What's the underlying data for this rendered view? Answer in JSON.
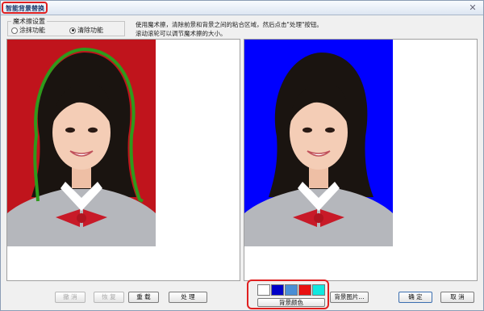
{
  "window": {
    "title": "智能背景替换",
    "close_glyph": "✕"
  },
  "mode_group": {
    "title": "魔术擦设置",
    "options": [
      {
        "label": "涂抹功能",
        "selected": false
      },
      {
        "label": "清除功能",
        "selected": true
      }
    ]
  },
  "instructions": {
    "line1": "使用魔术擦，清除前景和背景之间的粘合区域，然后点击\"处理\"按钮。",
    "line2": "滚动滚轮可以调节魔术擦的大小。"
  },
  "left_buttons": {
    "undo": "撤 消",
    "redo": "恢 复",
    "reload": "重 载",
    "process": "处 理"
  },
  "color_picker": {
    "label": "背景颜色",
    "swatches": [
      {
        "name": "white-swatch",
        "color": "#ffffff"
      },
      {
        "name": "dark-blue-swatch",
        "color": "#0000c8"
      },
      {
        "name": "light-blue-swatch",
        "color": "#4a8fd6"
      },
      {
        "name": "red-swatch",
        "color": "#e81010"
      },
      {
        "name": "cyan-swatch",
        "color": "#10e8e0"
      }
    ]
  },
  "right_buttons": {
    "background_image": "背景图片...",
    "ok": "确 定",
    "cancel": "取 消"
  },
  "colors": {
    "original_background": "#c0141c",
    "replaced_background": "#0000ff",
    "selection_outline": "#2f9a1c",
    "highlight": "#e02020"
  }
}
